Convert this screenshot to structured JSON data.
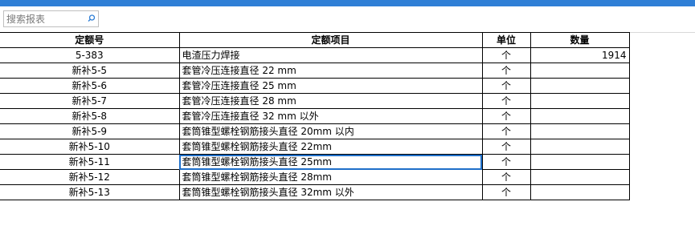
{
  "search": {
    "placeholder": "搜索报表"
  },
  "table": {
    "headers": {
      "code": "定额号",
      "item": "定额项目",
      "unit": "单位",
      "qty": "数量"
    },
    "rows": [
      {
        "code": "5-383",
        "item": "电渣压力焊接",
        "unit": "个",
        "qty": "1914"
      },
      {
        "code": "新补5-5",
        "item": "套管冷压连接直径 22 mm",
        "unit": "个",
        "qty": ""
      },
      {
        "code": "新补5-6",
        "item": "套管冷压连接直径 25 mm",
        "unit": "个",
        "qty": ""
      },
      {
        "code": "新补5-7",
        "item": "套管冷压连接直径 28 mm",
        "unit": "个",
        "qty": ""
      },
      {
        "code": "新补5-8",
        "item": "套管冷压连接直径 32 mm 以外",
        "unit": "个",
        "qty": ""
      },
      {
        "code": "新补5-9",
        "item": "套筒锥型螺栓钢筋接头直径 20mm 以内",
        "unit": "个",
        "qty": ""
      },
      {
        "code": "新补5-10",
        "item": "套筒锥型螺栓钢筋接头直径 22mm",
        "unit": "个",
        "qty": ""
      },
      {
        "code": "新补5-11",
        "item": "套筒锥型螺栓钢筋接头直径 25mm",
        "unit": "个",
        "qty": ""
      },
      {
        "code": "新补5-12",
        "item": "套筒锥型螺栓钢筋接头直径 28mm",
        "unit": "个",
        "qty": ""
      },
      {
        "code": "新补5-13",
        "item": "套筒锥型螺栓钢筋接头直径 32mm 以外",
        "unit": "个",
        "qty": ""
      }
    ]
  },
  "colors": {
    "accent": "#2f7fd6",
    "selection": "#1f6fc9"
  }
}
